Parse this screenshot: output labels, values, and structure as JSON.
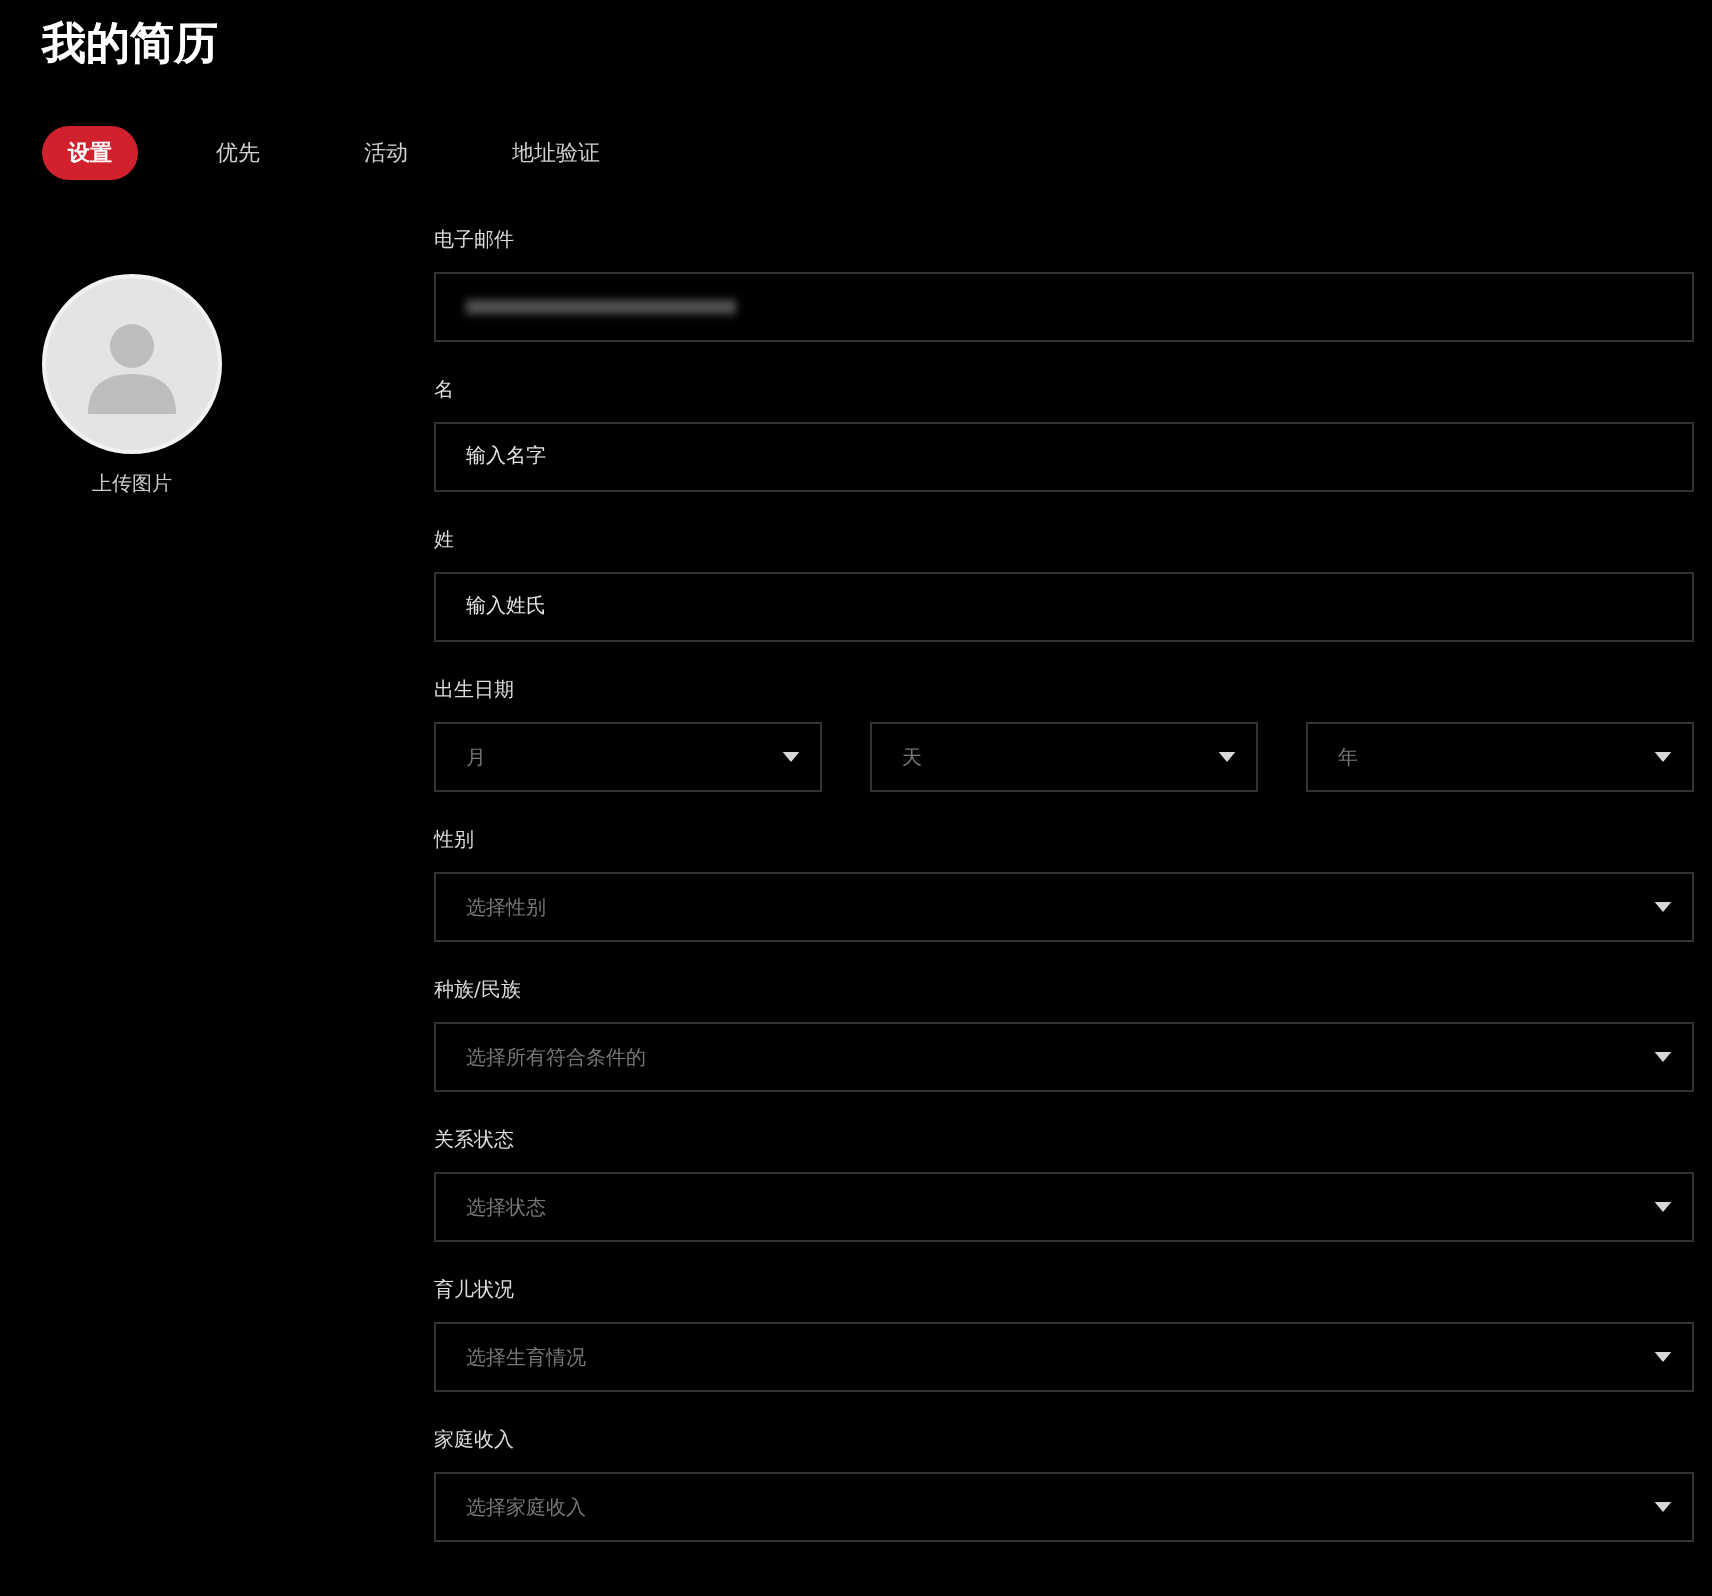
{
  "title": "我的简历",
  "tabs": [
    {
      "label": "设置",
      "selected": true
    },
    {
      "label": "优先",
      "selected": false
    },
    {
      "label": "活动",
      "selected": false
    },
    {
      "label": "地址验证",
      "selected": false
    }
  ],
  "avatar": {
    "caption": "上传图片"
  },
  "fields": [
    {
      "kind": "email",
      "label": "电子邮件",
      "value_hidden": true
    },
    {
      "kind": "text",
      "label": "名",
      "placeholder": "输入名字"
    },
    {
      "kind": "text",
      "label": "姓",
      "placeholder": "输入姓氏"
    },
    {
      "kind": "date",
      "label": "出生日期",
      "parts": [
        {
          "placeholder": "月"
        },
        {
          "placeholder": "天"
        },
        {
          "placeholder": "年"
        }
      ]
    },
    {
      "kind": "select",
      "label": "性别",
      "placeholder": "选择性别"
    },
    {
      "kind": "select",
      "label": "种族/民族",
      "placeholder": "选择所有符合条件的"
    },
    {
      "kind": "select",
      "label": "关系状态",
      "placeholder": "选择状态"
    },
    {
      "kind": "select",
      "label": "育儿状况",
      "placeholder": "选择生育情况"
    },
    {
      "kind": "select",
      "label": "家庭收入",
      "placeholder": "选择家庭收入"
    }
  ]
}
